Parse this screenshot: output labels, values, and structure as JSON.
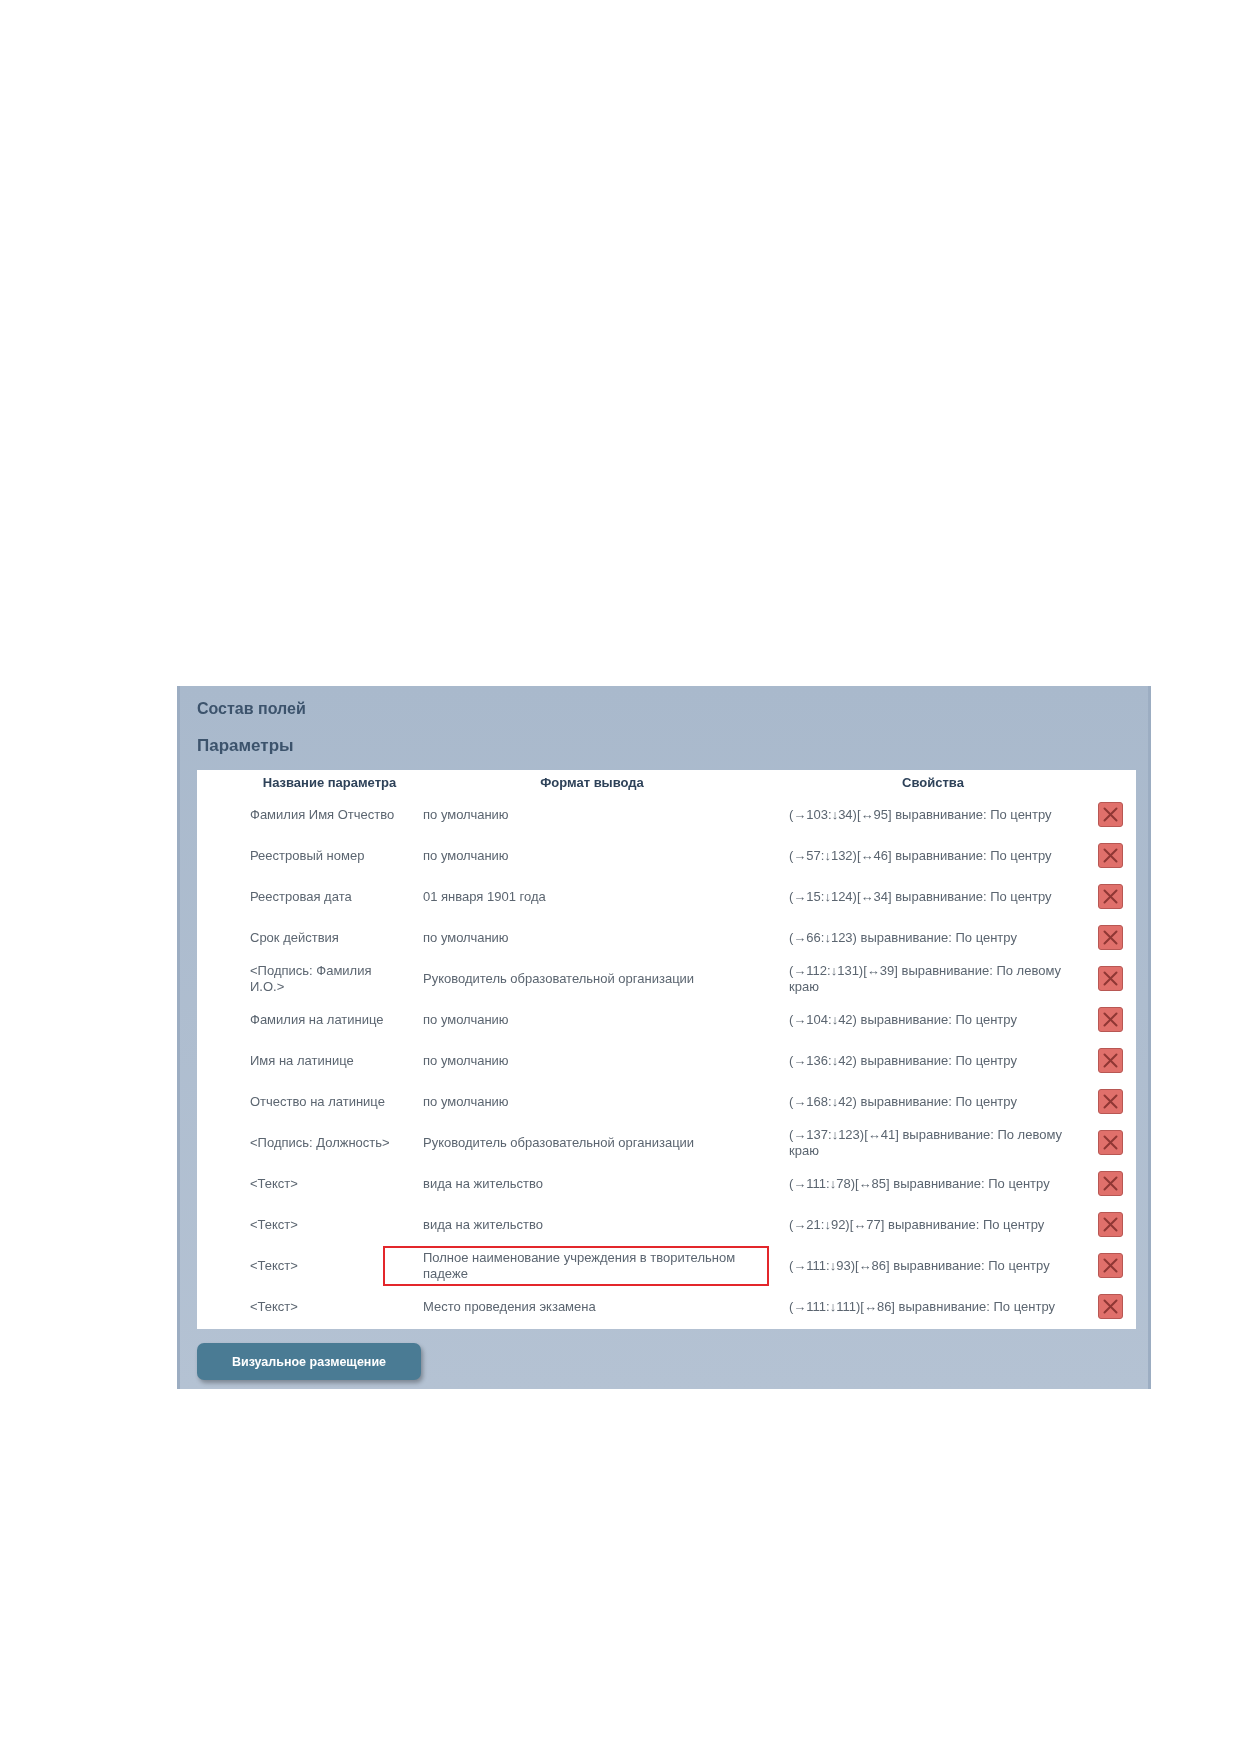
{
  "panel": {
    "title": "Состав полей",
    "section": "Параметры"
  },
  "table": {
    "columns": [
      "Название параметра",
      "Формат вывода",
      "Свойства"
    ],
    "rows": [
      {
        "name": "Фамилия Имя Отчество",
        "format": "по умолчанию",
        "properties": "(→103:↓34)[↔95] выравнивание: По центру",
        "highlighted": false
      },
      {
        "name": "Реестровый номер",
        "format": "по умолчанию",
        "properties": "(→57:↓132)[↔46] выравнивание: По центру",
        "highlighted": false
      },
      {
        "name": "Реестровая дата",
        "format": "01 января 1901 года",
        "properties": "(→15:↓124)[↔34] выравнивание: По центру",
        "highlighted": false
      },
      {
        "name": "Срок действия",
        "format": "по умолчанию",
        "properties": "(→66:↓123) выравнивание: По центру",
        "highlighted": false
      },
      {
        "name": "<Подпись: Фамилия И.О.>",
        "format": "Руководитель образовательной организации",
        "properties": "(→112:↓131)[↔39] выравнивание: По левому краю",
        "highlighted": false
      },
      {
        "name": "Фамилия на латинице",
        "format": "по умолчанию",
        "properties": "(→104:↓42) выравнивание: По центру",
        "highlighted": false
      },
      {
        "name": "Имя на латинице",
        "format": "по умолчанию",
        "properties": "(→136:↓42) выравнивание: По центру",
        "highlighted": false
      },
      {
        "name": "Отчество на латинице",
        "format": "по умолчанию",
        "properties": "(→168:↓42) выравнивание: По центру",
        "highlighted": false
      },
      {
        "name": "<Подпись: Должность>",
        "format": "Руководитель образовательной организации",
        "properties": "(→137:↓123)[↔41] выравнивание: По левому краю",
        "highlighted": false
      },
      {
        "name": "<Текст>",
        "format": "вида на жительство",
        "properties": "(→111:↓78)[↔85] выравнивание: По центру",
        "highlighted": false
      },
      {
        "name": "<Текст>",
        "format": "вида на жительство",
        "properties": "(→21:↓92)[↔77] выравнивание: По центру",
        "highlighted": false
      },
      {
        "name": "<Текст>",
        "format": "Полное наименование учреждения в творительном падеже",
        "properties": "(→111:↓93)[↔86] выравнивание: По центру",
        "highlighted": true
      },
      {
        "name": "<Текст>",
        "format": "Место проведения экзамена",
        "properties": "(→111:↓111)[↔86] выравнивание: По центру",
        "highlighted": false
      }
    ]
  },
  "buttons": [
    {
      "label": "Визуальное размещение"
    }
  ]
}
